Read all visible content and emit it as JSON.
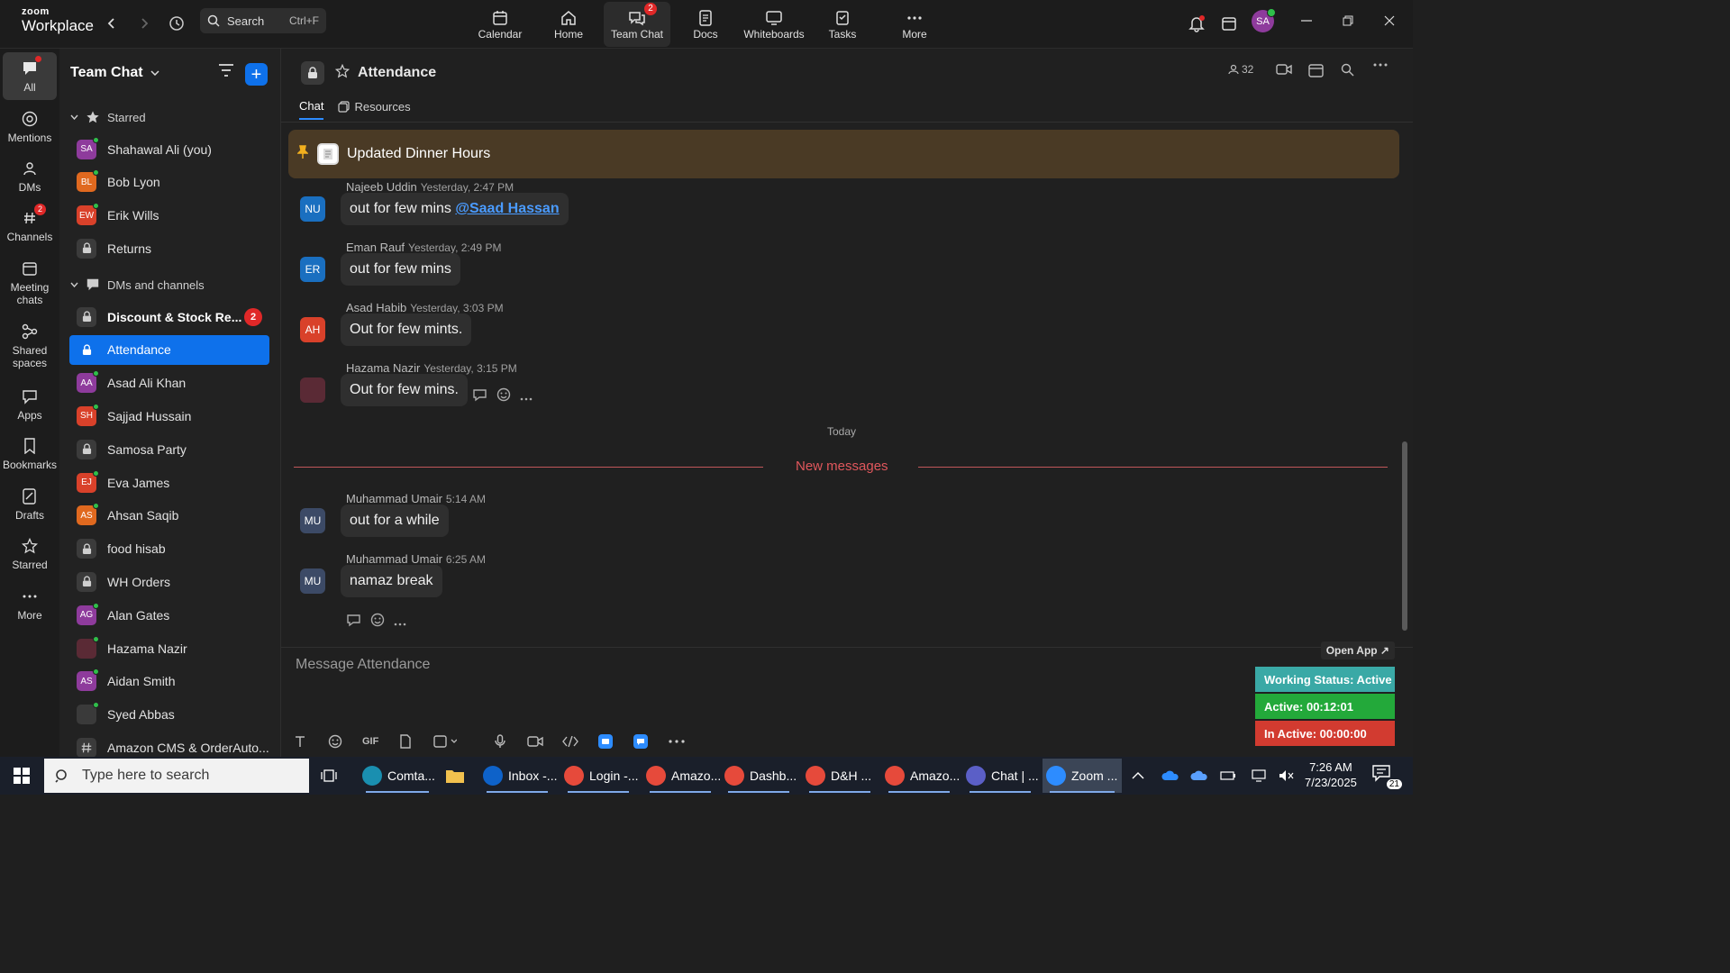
{
  "brand": {
    "line1": "zoom",
    "line2": "Workplace"
  },
  "search": {
    "label": "Search",
    "shortcut": "Ctrl+F"
  },
  "nav": [
    {
      "label": "Calendar",
      "icon": "calendar-icon"
    },
    {
      "label": "Home",
      "icon": "home-icon"
    },
    {
      "label": "Team Chat",
      "icon": "chat-icon",
      "badge": "2",
      "active": true
    },
    {
      "label": "Docs",
      "icon": "docs-icon"
    },
    {
      "label": "Whiteboards",
      "icon": "whiteboard-icon"
    },
    {
      "label": "Tasks",
      "icon": "tasks-icon"
    },
    {
      "label": "More",
      "icon": "more-icon"
    }
  ],
  "user_initials": "SA",
  "rail": [
    {
      "label": "All",
      "icon": "chat-bubble-icon",
      "active": true
    },
    {
      "label": "Mentions",
      "icon": "at-icon"
    },
    {
      "label": "DMs",
      "icon": "people-icon"
    },
    {
      "label": "Channels",
      "icon": "hash-icon",
      "badge": "2"
    },
    {
      "label": "Meeting chats",
      "icon": "calendar-icon"
    },
    {
      "label": "Shared spaces",
      "icon": "shared-icon"
    },
    {
      "label": "Apps",
      "icon": "apps-icon"
    },
    {
      "label": "Bookmarks",
      "icon": "bookmark-icon"
    },
    {
      "label": "Drafts",
      "icon": "drafts-icon"
    },
    {
      "label": "Starred",
      "icon": "star-icon"
    },
    {
      "label": "More",
      "icon": "more-icon"
    }
  ],
  "sidebar": {
    "title": "Team Chat",
    "starred_label": "Starred",
    "dms_label": "DMs and channels",
    "starred": [
      {
        "name": "Shahawal Ali (you)",
        "initials": "SA",
        "color": "#8e3b9c",
        "type": "dm"
      },
      {
        "name": "Bob Lyon",
        "initials": "BL",
        "color": "#e0691f",
        "type": "dm"
      },
      {
        "name": "Erik Wills",
        "initials": "EW",
        "color": "#d9412a",
        "type": "dm"
      },
      {
        "name": "Returns",
        "type": "channel"
      }
    ],
    "channels": [
      {
        "name": "Discount & Stock Re...",
        "type": "channel",
        "badge": "2",
        "bold": true
      },
      {
        "name": "Attendance",
        "type": "channel",
        "selected": true
      },
      {
        "name": "Asad Ali Khan",
        "initials": "AA",
        "color": "#8e3b9c",
        "type": "dm"
      },
      {
        "name": "Sajjad Hussain",
        "initials": "SH",
        "color": "#d9412a",
        "type": "dm"
      },
      {
        "name": "Samosa Party",
        "type": "channel"
      },
      {
        "name": "Eva James",
        "initials": "EJ",
        "color": "#d9412a",
        "type": "dm"
      },
      {
        "name": "Ahsan Saqib",
        "initials": "AS",
        "color": "#e0691f",
        "type": "dm"
      },
      {
        "name": "food hisab",
        "type": "channel"
      },
      {
        "name": "WH Orders",
        "type": "channel"
      },
      {
        "name": "Alan Gates",
        "initials": "AG",
        "color": "#8e3b9c",
        "type": "dm"
      },
      {
        "name": "Hazama Nazir",
        "initials": "",
        "color": "#5a2a35",
        "type": "dm"
      },
      {
        "name": "Aidan Smith",
        "initials": "AS",
        "color": "#8e3b9c",
        "type": "dm"
      },
      {
        "name": "Syed Abbas",
        "initials": "",
        "color": "#3a3a3a",
        "type": "dm"
      },
      {
        "name": "Amazon CMS & OrderAuto...",
        "type": "hash"
      }
    ]
  },
  "channel": {
    "title": "Attendance",
    "tabs": [
      "Chat",
      "Resources"
    ],
    "member_count": "32",
    "pinned": "Updated Dinner Hours",
    "today_label": "Today",
    "new_messages_label": "New messages",
    "composer_placeholder": "Message Attendance"
  },
  "messages": [
    {
      "author": "Najeeb Uddin",
      "time": "Yesterday, 2:47 PM",
      "initials": "NU",
      "color": "#1a6fc0",
      "text": "out for few mins ",
      "mention": "@Saad Hassan"
    },
    {
      "author": "Eman Rauf",
      "time": "Yesterday, 2:49 PM",
      "initials": "ER",
      "color": "#1a6fc0",
      "text": "out for few mins"
    },
    {
      "author": "Asad Habib",
      "time": "Yesterday, 3:03 PM",
      "initials": "AH",
      "color": "#d9412a",
      "text": "Out for few mints."
    },
    {
      "author": "Hazama Nazir",
      "time": "Yesterday, 3:15 PM",
      "initials": "",
      "color": "#5a2a35",
      "text": "Out for few mins."
    },
    {
      "author": "Muhammad Umair",
      "time": "5:14 AM",
      "initials": "MU",
      "color": "#3c4a66",
      "text": "out for a while"
    },
    {
      "author": "Muhammad Umair",
      "time": "6:25 AM",
      "initials": "MU",
      "color": "#3c4a66",
      "text": "namaz break"
    }
  ],
  "widget": {
    "open_app": "Open App ↗",
    "status": "Working Status: Active",
    "active": "Active: 00:12:01",
    "inactive": "In Active: 00:00:00",
    "colors": {
      "status": "#3aa9a6",
      "active": "#23a93a",
      "inactive": "#d23b30"
    }
  },
  "taskbar": {
    "search_placeholder": "Type here to search",
    "apps": [
      {
        "label": "Comta...",
        "color": "#1a8fb0"
      },
      {
        "label": "Inbox -...",
        "color": "#0e62c9"
      },
      {
        "label": "Login -...",
        "color": "#e64a3b"
      },
      {
        "label": "Amazo...",
        "color": "#e64a3b"
      },
      {
        "label": "Dashb...",
        "color": "#e64a3b"
      },
      {
        "label": "D&H ...",
        "color": "#e64a3b"
      },
      {
        "label": "Amazo...",
        "color": "#e64a3b"
      },
      {
        "label": "Chat | ...",
        "color": "#5b5fc7"
      },
      {
        "label": "Zoom ...",
        "color": "#2d8cff"
      }
    ],
    "time": "7:26 AM",
    "date": "7/23/2025",
    "notifications": "21"
  }
}
